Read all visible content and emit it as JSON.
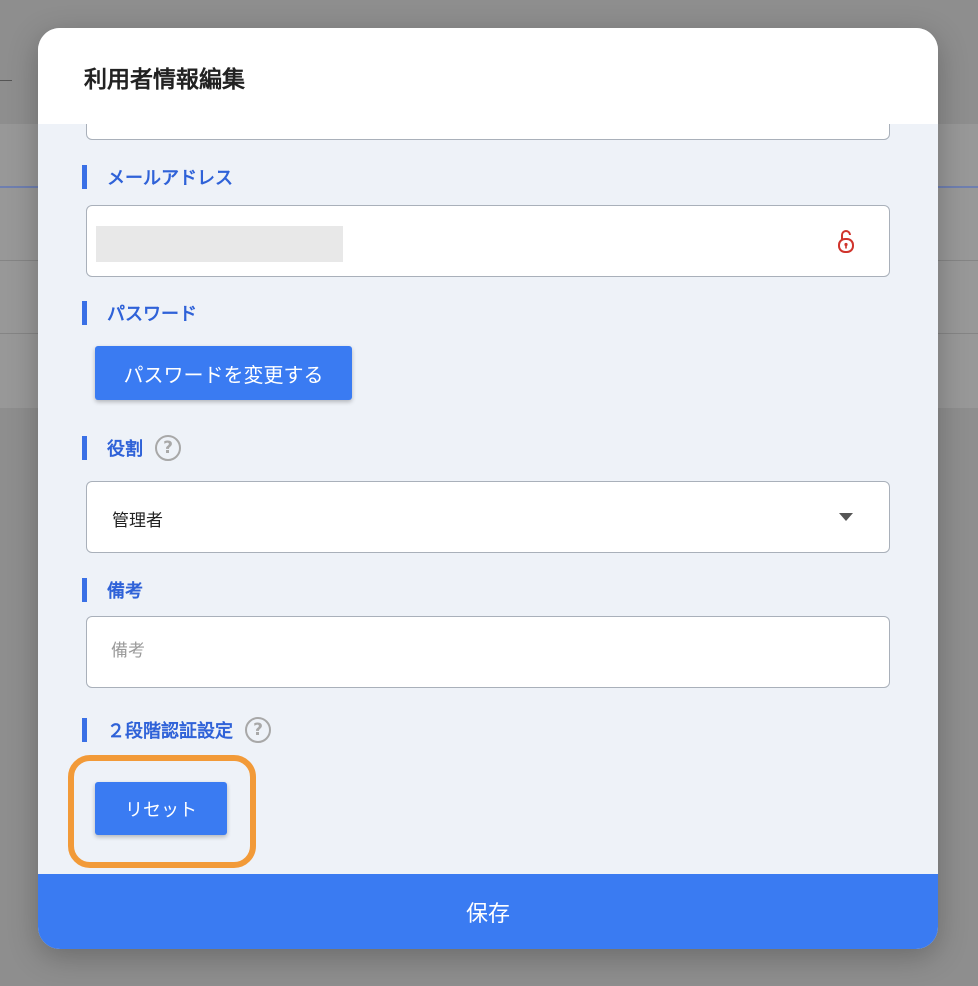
{
  "modal": {
    "title": "利用者情報編集"
  },
  "email": {
    "label": "メールアドレス",
    "lock_icon": "unlocked-padlock-icon"
  },
  "password": {
    "label": "パスワード",
    "change_button": "パスワードを変更する"
  },
  "role": {
    "label": "役割",
    "help_icon": "question-circle-icon",
    "help_glyph": "?",
    "selected_value": "管理者"
  },
  "notes": {
    "label": "備考",
    "placeholder": "備考",
    "value": ""
  },
  "two_factor": {
    "label": "２段階認証設定",
    "help_glyph": "?",
    "reset_button": "リセット"
  },
  "footer": {
    "save_button": "保存"
  },
  "colors": {
    "accent": "#3a7bf2",
    "label_blue": "#2f62d8",
    "highlight": "#f29a38",
    "lock_red": "#d0342c"
  }
}
